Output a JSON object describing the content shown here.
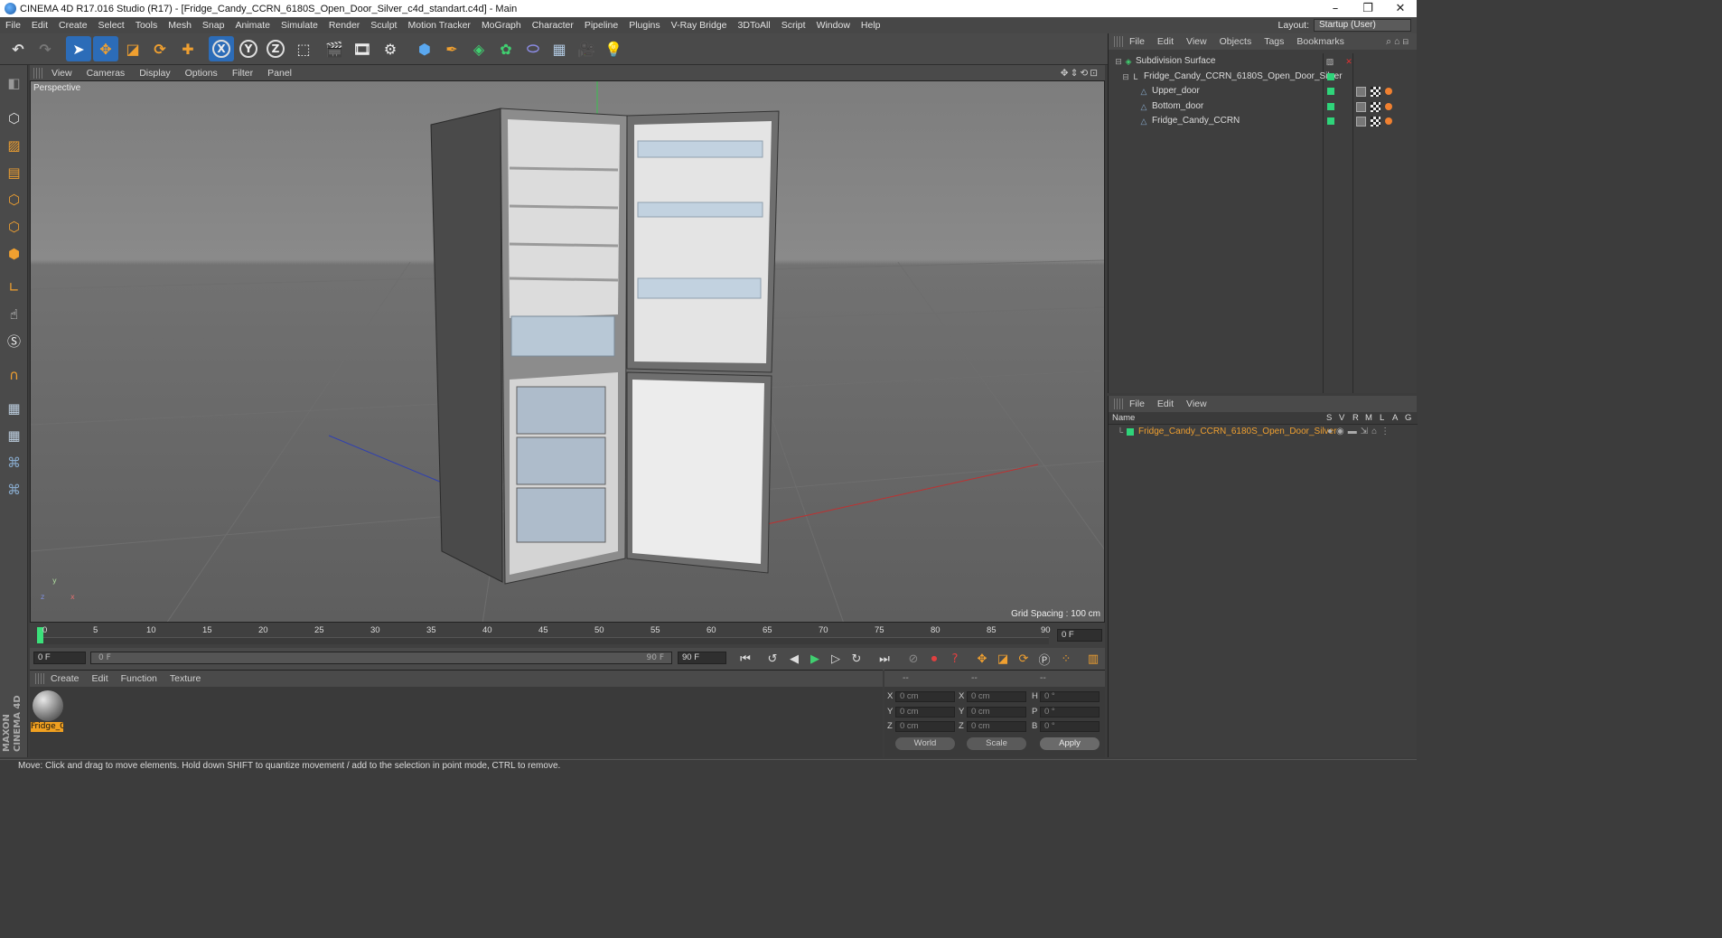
{
  "window": {
    "title": "CINEMA 4D R17.016 Studio (R17) - [Fridge_Candy_CCRN_6180S_Open_Door_Silver_c4d_standart.c4d] - Main",
    "minimize": "–",
    "restore": "❐",
    "close": "✕"
  },
  "menu": {
    "items": [
      "File",
      "Edit",
      "Create",
      "Select",
      "Tools",
      "Mesh",
      "Snap",
      "Animate",
      "Simulate",
      "Render",
      "Sculpt",
      "Motion Tracker",
      "MoGraph",
      "Character",
      "Pipeline",
      "Plugins",
      "V-Ray Bridge",
      "3DToAll",
      "Script",
      "Window",
      "Help"
    ],
    "layout_label": "Layout:",
    "layout_value": "Startup (User)"
  },
  "toolbar": {
    "icons": [
      "undo-icon",
      "redo-icon",
      "select-icon",
      "move-icon",
      "scale-icon",
      "rotate-icon",
      "transform-icon",
      "x-axis-icon",
      "y-axis-icon",
      "z-axis-icon",
      "world-coord-icon",
      "render-view-icon",
      "render-picture-icon",
      "render-settings-icon",
      "cube-icon",
      "spline-pen-icon",
      "subdivision-icon",
      "array-icon",
      "deformer-icon",
      "floor-icon",
      "camera-icon",
      "light-icon"
    ],
    "x_label": "X",
    "y_label": "Y",
    "z_label": "Z"
  },
  "viewport": {
    "menu": [
      "View",
      "Cameras",
      "Display",
      "Options",
      "Filter",
      "Panel"
    ],
    "label": "Perspective",
    "grid_spacing": "Grid Spacing : 100 cm",
    "axis_y": "y",
    "axis_x": "x",
    "axis_z": "z"
  },
  "timeline": {
    "ticks": [
      "0",
      "5",
      "10",
      "15",
      "20",
      "25",
      "30",
      "35",
      "40",
      "45",
      "50",
      "55",
      "60",
      "65",
      "70",
      "75",
      "80",
      "85",
      "90"
    ],
    "current_frame": "0 F",
    "start_frame": "0 F",
    "range_start": "0 F",
    "range_end": "90 F",
    "end_frame": "90 F"
  },
  "materials": {
    "menu": [
      "Create",
      "Edit",
      "Function",
      "Texture"
    ],
    "items": [
      {
        "name": "Fridge_C"
      }
    ]
  },
  "coordinates": {
    "header": [
      "--",
      "--",
      "--"
    ],
    "rows": [
      {
        "a": "X",
        "av": "0 cm",
        "b": "X",
        "bv": "0 cm",
        "c": "H",
        "cv": "0 °"
      },
      {
        "a": "Y",
        "av": "0 cm",
        "b": "Y",
        "bv": "0 cm",
        "c": "P",
        "cv": "0 °"
      },
      {
        "a": "Z",
        "av": "0 cm",
        "b": "Z",
        "bv": "0 cm",
        "c": "B",
        "cv": "0 °"
      }
    ],
    "mode": "World",
    "transform": "Scale",
    "apply": "Apply"
  },
  "object_manager": {
    "menu": [
      "File",
      "Edit",
      "View",
      "Objects",
      "Tags",
      "Bookmarks"
    ],
    "objects": [
      {
        "name": "Subdivision Surface"
      },
      {
        "name": "Fridge_Candy_CCRN_6180S_Open_Door_Silver"
      },
      {
        "name": "Upper_door"
      },
      {
        "name": "Bottom_door"
      },
      {
        "name": "Fridge_Candy_CCRN"
      }
    ]
  },
  "layers": {
    "menu": [
      "File",
      "Edit",
      "View"
    ],
    "columns": [
      "Name",
      "S",
      "V",
      "R",
      "M",
      "L",
      "A",
      "G"
    ],
    "items": [
      {
        "name": "Fridge_Candy_CCRN_6180S_Open_Door_Silver"
      }
    ]
  },
  "brand": {
    "line1": "MAXON",
    "line2": "CINEMA 4D"
  },
  "status": "Move: Click and drag to move elements. Hold down SHIFT to quantize movement / add to the selection in point mode, CTRL to remove.",
  "colors": {
    "accent": "#2c6cb8",
    "green": "#2fd47a",
    "orange": "#f0a020",
    "selected_text": "#f0a030"
  }
}
